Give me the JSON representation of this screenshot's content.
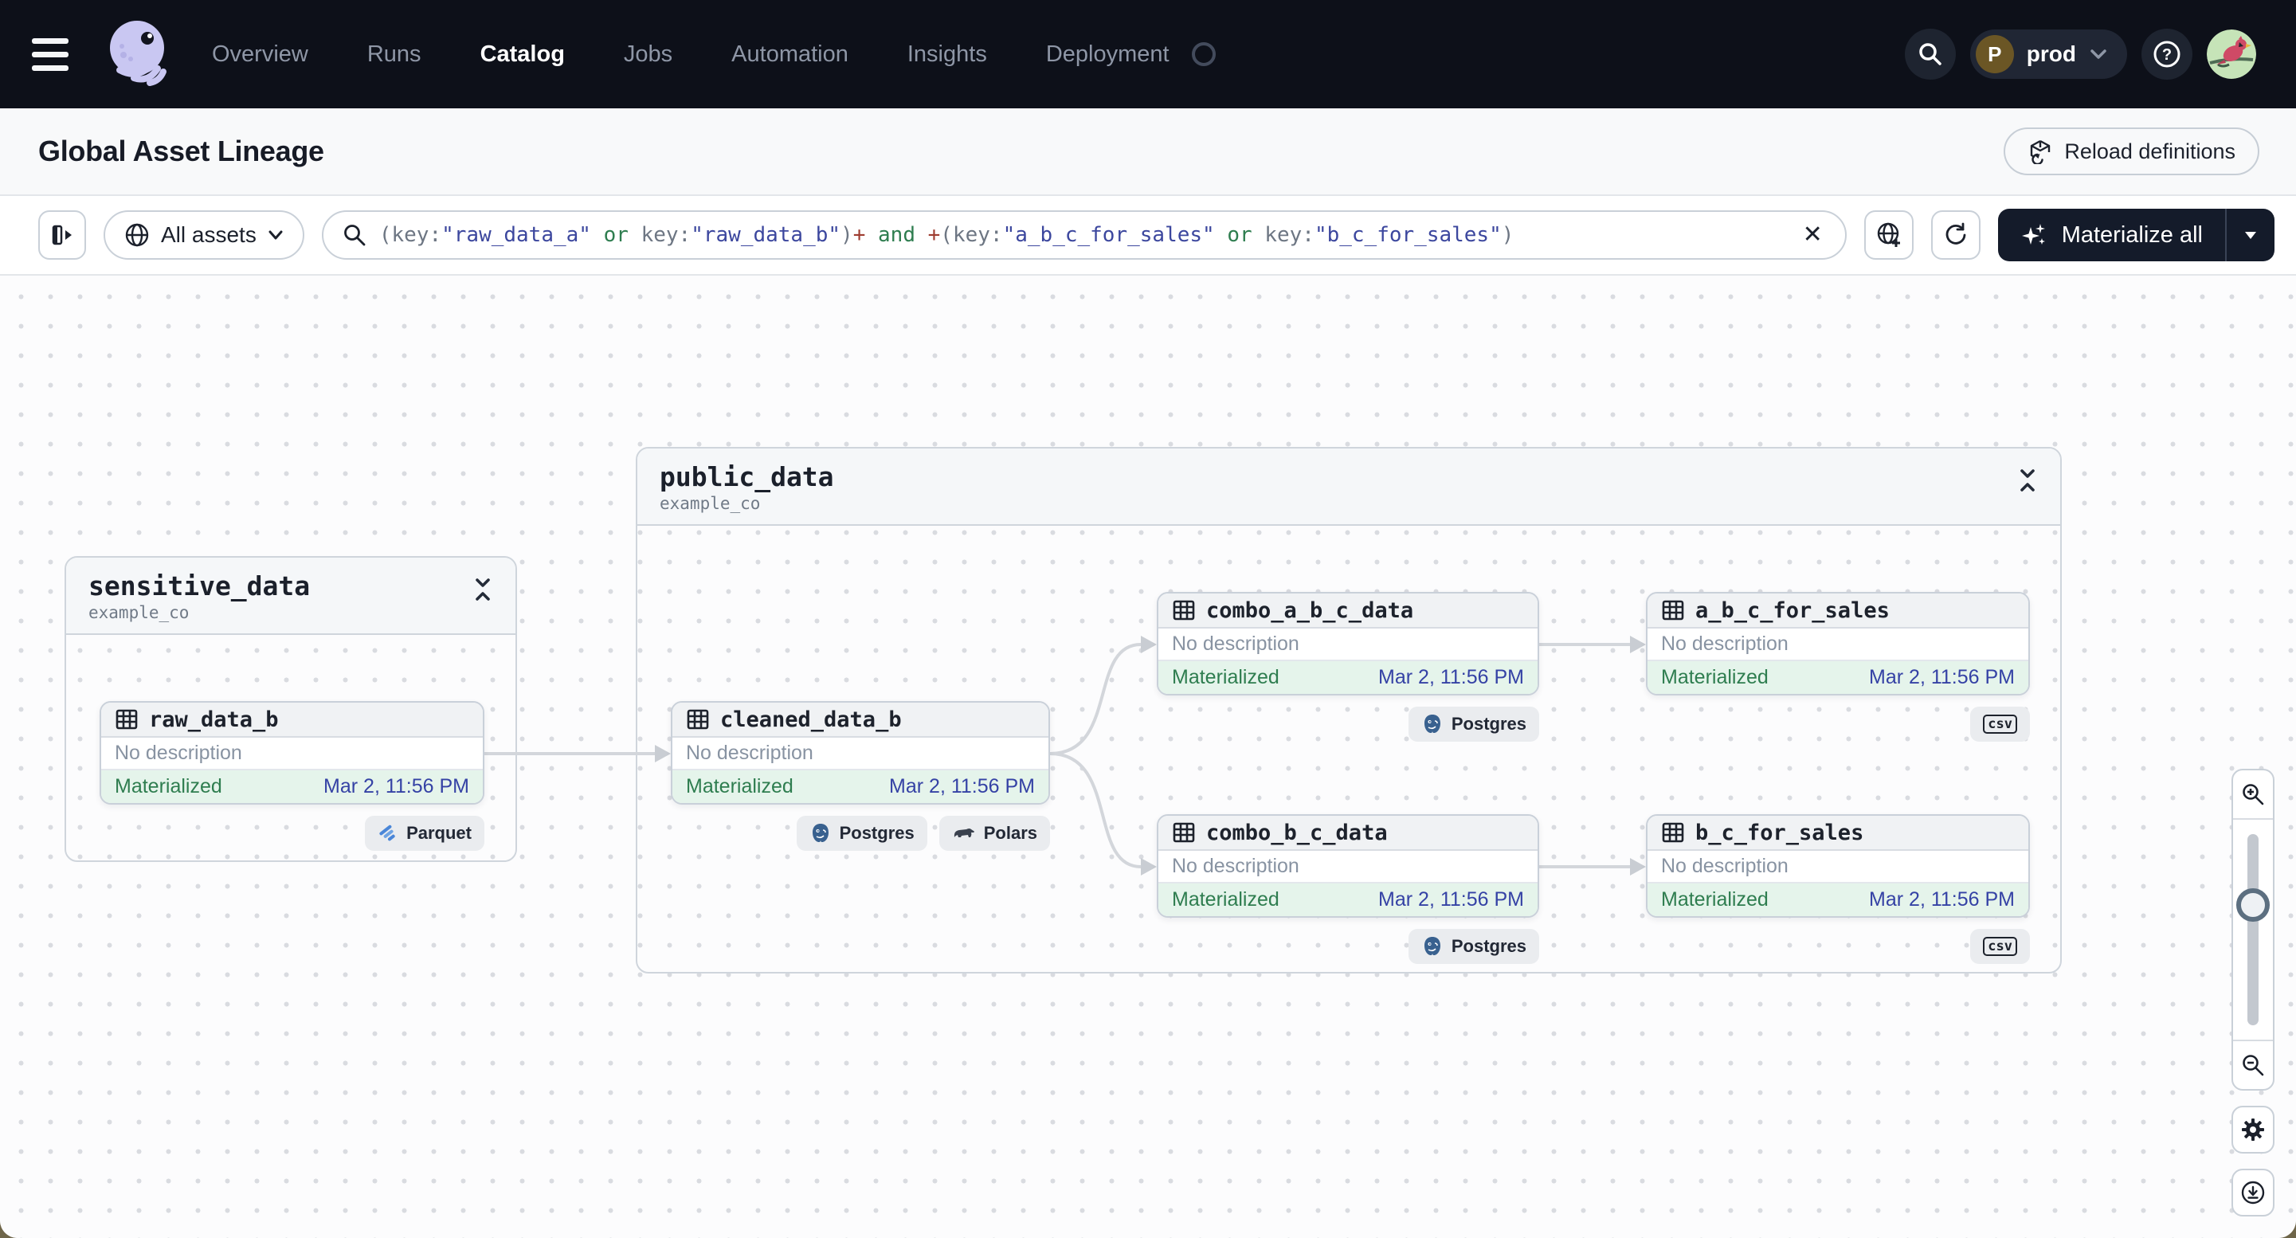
{
  "nav": {
    "items": [
      {
        "label": "Overview"
      },
      {
        "label": "Runs"
      },
      {
        "label": "Catalog"
      },
      {
        "label": "Jobs"
      },
      {
        "label": "Automation"
      },
      {
        "label": "Insights"
      },
      {
        "label": "Deployment"
      }
    ],
    "active_item": "Catalog",
    "env": {
      "initial": "P",
      "name": "prod"
    }
  },
  "header": {
    "title": "Global Asset Lineage",
    "reload_button": "Reload definitions"
  },
  "toolbar": {
    "assets_filter": "All assets",
    "materialize_button": "Materialize all",
    "query_segments": [
      {
        "t": "(",
        "c": "p"
      },
      {
        "t": "key:",
        "c": "k"
      },
      {
        "t": "\"raw_data_a\"",
        "c": "s"
      },
      {
        "t": " or ",
        "c": "o"
      },
      {
        "t": "key:",
        "c": "k"
      },
      {
        "t": "\"raw_data_b\"",
        "c": "s"
      },
      {
        "t": ")",
        "c": "p"
      },
      {
        "t": "+",
        "c": "plus"
      },
      {
        "t": " and ",
        "c": "o"
      },
      {
        "t": "+",
        "c": "plus"
      },
      {
        "t": "(",
        "c": "p"
      },
      {
        "t": "key:",
        "c": "k"
      },
      {
        "t": "\"a_b_c_for_sales\"",
        "c": "s"
      },
      {
        "t": " or ",
        "c": "o"
      },
      {
        "t": "key:",
        "c": "k"
      },
      {
        "t": "\"b_c_for_sales\"",
        "c": "s"
      },
      {
        "t": ")",
        "c": "p"
      }
    ]
  },
  "graph": {
    "groups": [
      {
        "name": "sensitive_data",
        "subtitle": "example_co"
      },
      {
        "name": "public_data",
        "subtitle": "example_co"
      }
    ],
    "nodes": [
      {
        "name": "raw_data_b",
        "description": "No description",
        "status": "Materialized",
        "date": "Mar 2, 11:56 PM",
        "badges": [
          "Parquet"
        ]
      },
      {
        "name": "cleaned_data_b",
        "description": "No description",
        "status": "Materialized",
        "date": "Mar 2, 11:56 PM",
        "badges": [
          "Postgres",
          "Polars"
        ]
      },
      {
        "name": "combo_a_b_c_data",
        "description": "No description",
        "status": "Materialized",
        "date": "Mar 2, 11:56 PM",
        "badges": [
          "Postgres"
        ]
      },
      {
        "name": "a_b_c_for_sales",
        "description": "No description",
        "status": "Materialized",
        "date": "Mar 2, 11:56 PM",
        "badges": [
          "csv"
        ]
      },
      {
        "name": "combo_b_c_data",
        "description": "No description",
        "status": "Materialized",
        "date": "Mar 2, 11:56 PM",
        "badges": [
          "Postgres"
        ]
      },
      {
        "name": "b_c_for_sales",
        "description": "No description",
        "status": "Materialized",
        "date": "Mar 2, 11:56 PM",
        "badges": [
          "csv"
        ]
      }
    ]
  },
  "colors": {
    "nav_bg": "#0d1019",
    "accent_dark": "#141b2a",
    "materialized_green": "#2e7d4f",
    "materialized_bg": "#e5f4eb",
    "date_navy": "#3542a5",
    "edge": "#d3d6db",
    "logo_lavender": "#c9c7f2"
  }
}
